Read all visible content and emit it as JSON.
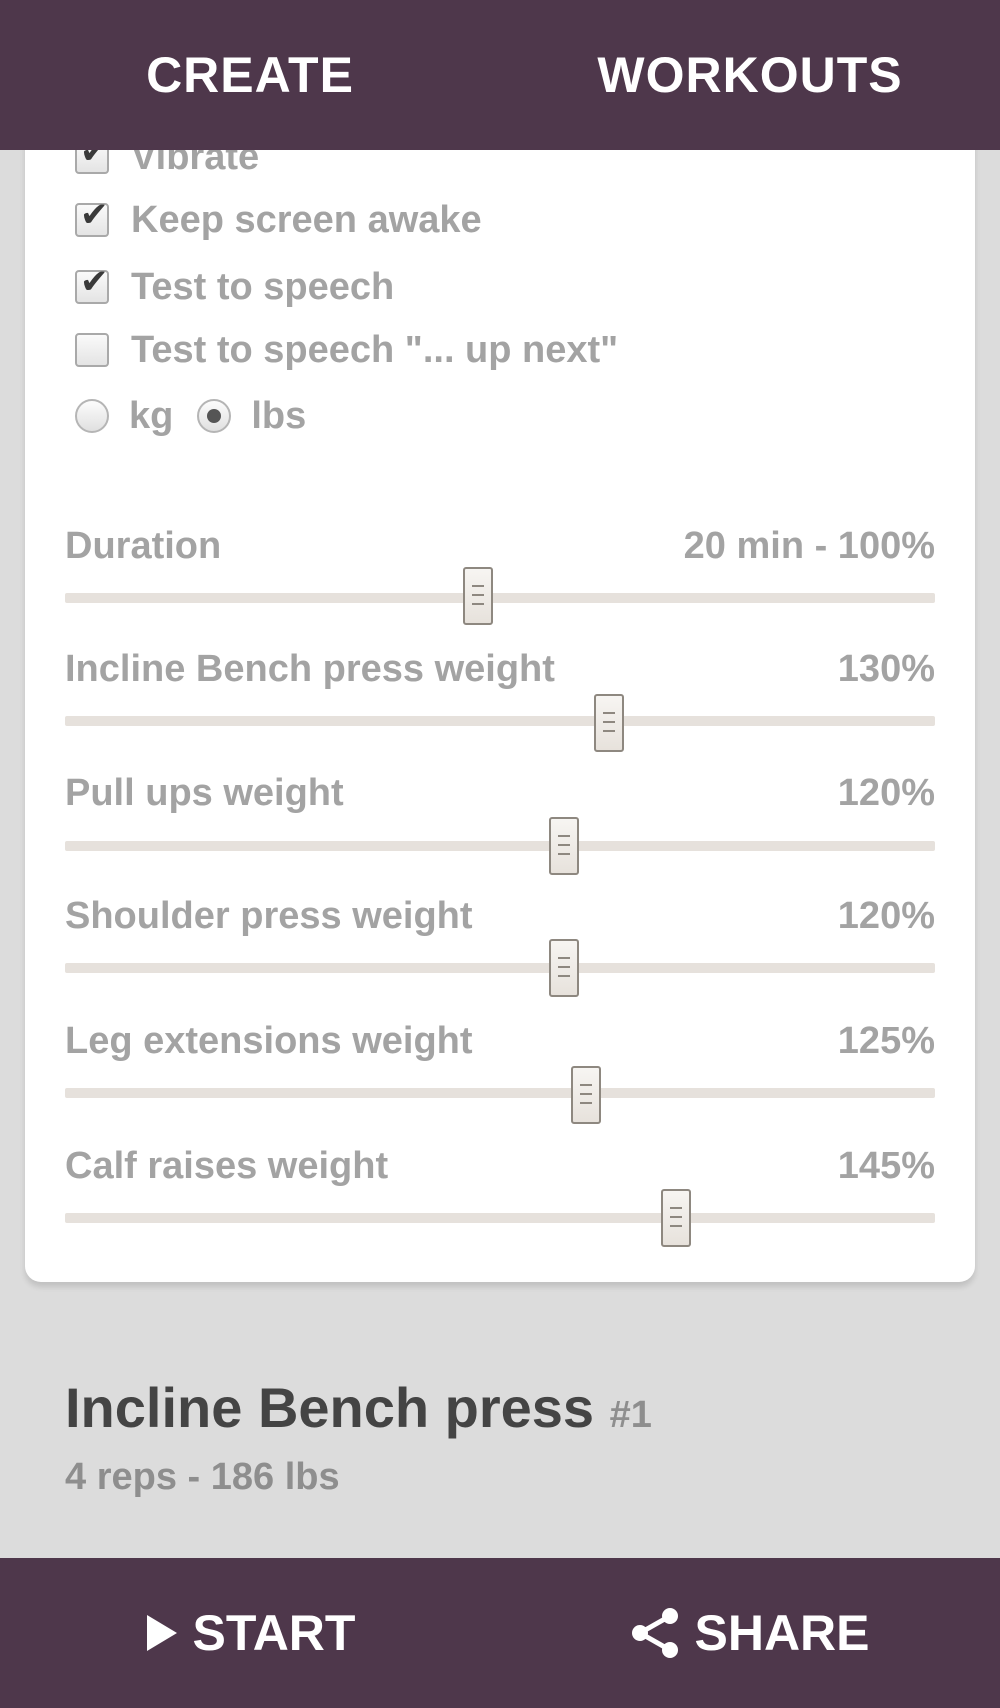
{
  "header": {
    "tabs": [
      {
        "label": "CREATE"
      },
      {
        "label": "WORKOUTS"
      }
    ]
  },
  "options": {
    "checkboxes": [
      {
        "label": "Vibrate",
        "checked": true
      },
      {
        "label": "Keep screen awake",
        "checked": true
      },
      {
        "label": "Test to speech",
        "checked": true
      },
      {
        "label": "Test to speech \"... up next\"",
        "checked": false
      }
    ],
    "units": {
      "options": [
        "kg",
        "lbs"
      ],
      "selected": "lbs"
    }
  },
  "sliders": [
    {
      "label": "Duration",
      "value_text": "20 min - 100%",
      "level": 0.475
    },
    {
      "label": "Incline Bench press weight",
      "value_text": "130%",
      "level": 0.625
    },
    {
      "label": "Pull ups weight",
      "value_text": "120%",
      "level": 0.574
    },
    {
      "label": "Shoulder press weight",
      "value_text": "120%",
      "level": 0.574
    },
    {
      "label": "Leg extensions weight",
      "value_text": "125%",
      "level": 0.599
    },
    {
      "label": "Calf raises weight",
      "value_text": "145%",
      "level": 0.702
    }
  ],
  "current_exercise": {
    "name": "Incline Bench press",
    "number": "#1",
    "details": "4 reps - 186 lbs"
  },
  "footer": {
    "start_label": "START",
    "share_label": "SHARE"
  },
  "colors": {
    "bar": "#4e374b",
    "background": "#dcdcdc",
    "card": "#ffffff",
    "muted_text": "#a3a3a3"
  },
  "icons": {
    "start": "play-icon",
    "share": "share-icon"
  }
}
